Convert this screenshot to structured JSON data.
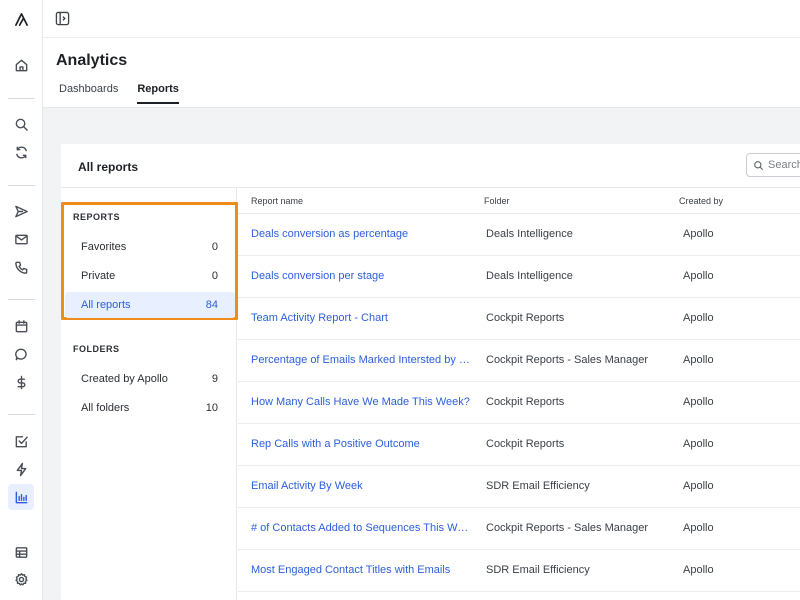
{
  "header": {
    "title": "Analytics",
    "tabs": [
      {
        "label": "Dashboards",
        "active": false
      },
      {
        "label": "Reports",
        "active": true
      }
    ]
  },
  "card": {
    "title": "All reports",
    "search_placeholder": "Search"
  },
  "filters": {
    "reports_heading": "REPORTS",
    "reports": [
      {
        "label": "Favorites",
        "count": "0"
      },
      {
        "label": "Private",
        "count": "0"
      },
      {
        "label": "All reports",
        "count": "84"
      }
    ],
    "folders_heading": "FOLDERS",
    "folders": [
      {
        "label": "Created by Apollo",
        "count": "9"
      },
      {
        "label": "All folders",
        "count": "10"
      }
    ]
  },
  "table": {
    "columns": [
      "Report name",
      "Folder",
      "Created by"
    ],
    "rows": [
      {
        "name": "Deals conversion as percentage",
        "folder": "Deals Intelligence",
        "creator": "Apollo"
      },
      {
        "name": "Deals conversion per stage",
        "folder": "Deals Intelligence",
        "creator": "Apollo"
      },
      {
        "name": "Team Activity Report - Chart",
        "folder": "Cockpit Reports",
        "creator": "Apollo"
      },
      {
        "name": "Percentage of Emails Marked Intersted by Persona",
        "folder": "Cockpit Reports - Sales Manager",
        "creator": "Apollo"
      },
      {
        "name": "How Many Calls Have We Made This Week?",
        "folder": "Cockpit Reports",
        "creator": "Apollo"
      },
      {
        "name": "Rep Calls with a Positive Outcome",
        "folder": "Cockpit Reports",
        "creator": "Apollo"
      },
      {
        "name": "Email Activity By Week",
        "folder": "SDR Email Efficiency",
        "creator": "Apollo"
      },
      {
        "name": "# of Contacts Added to Sequences This Week",
        "folder": "Cockpit Reports - Sales Manager",
        "creator": "Apollo"
      },
      {
        "name": "Most Engaged Contact Titles with Emails",
        "folder": "SDR Email Efficiency",
        "creator": "Apollo"
      }
    ]
  },
  "colors": {
    "accent": "#2c5fdc",
    "highlight": "#f08c1e"
  },
  "icons": [
    "apollo-logo-icon",
    "home-icon",
    "search-icon",
    "refresh-icon",
    "send-icon",
    "mail-icon",
    "phone-icon",
    "calendar-icon",
    "chat-icon",
    "dollar-icon",
    "tasks-icon",
    "lightning-icon",
    "analytics-icon",
    "table-icon",
    "settings-icon",
    "sidebar-toggle-icon"
  ]
}
